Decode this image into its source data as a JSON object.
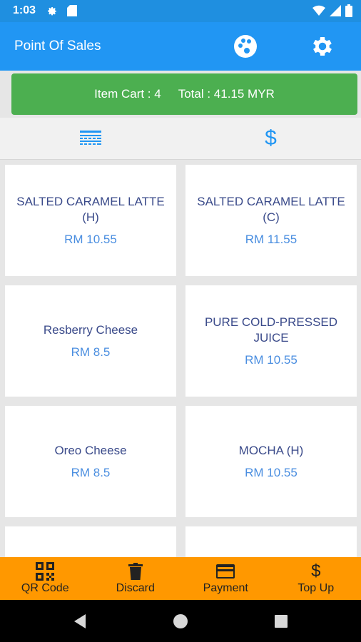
{
  "status_bar": {
    "time": "1:03"
  },
  "app_bar": {
    "title": "Point Of Sales",
    "icons": [
      "palette-icon",
      "settings-icon"
    ]
  },
  "cart": {
    "items_text": "Item Cart : 4",
    "total_text": "Total : 41.15 MYR"
  },
  "tabs": [
    {
      "name": "list-view",
      "icon": "list-view-icon"
    },
    {
      "name": "dollar",
      "icon": "dollar-icon"
    }
  ],
  "products": [
    {
      "name": "SALTED CARAMEL LATTE (H)",
      "price": "RM 10.55"
    },
    {
      "name": "SALTED CARAMEL LATTE (C)",
      "price": "RM 11.55"
    },
    {
      "name": "Resberry Cheese",
      "price": "RM 8.5"
    },
    {
      "name": "PURE COLD-PRESSED JUICE",
      "price": "RM 10.55"
    },
    {
      "name": "Oreo Cheese",
      "price": "RM 8.5"
    },
    {
      "name": "MOCHA (H)",
      "price": "RM 10.55"
    },
    {
      "name": "",
      "price": ""
    },
    {
      "name": "",
      "price": ""
    }
  ],
  "bottom_bar": [
    {
      "label": "QR Code",
      "icon": "qr-code-icon"
    },
    {
      "label": "Discard",
      "icon": "trash-icon"
    },
    {
      "label": "Payment",
      "icon": "credit-card-icon"
    },
    {
      "label": "Top Up",
      "icon": "dollar-icon"
    }
  ],
  "colors": {
    "primary": "#2196f3",
    "cart_green": "#4caf50",
    "bottom_orange": "#ff9800",
    "product_name": "#3a4a8a",
    "product_price": "#4a8ee0"
  }
}
